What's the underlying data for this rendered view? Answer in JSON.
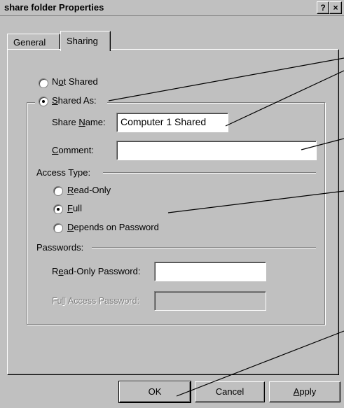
{
  "window": {
    "title": "share folder Properties",
    "help_btn": "?",
    "close_btn": "×"
  },
  "tabs": [
    {
      "label": "General",
      "active": false
    },
    {
      "label": "Sharing",
      "active": true
    }
  ],
  "sharing": {
    "not_shared": {
      "pre": "N",
      "acc": "o",
      "post": "t Shared",
      "selected": false
    },
    "shared_as": {
      "pre": "",
      "acc": "S",
      "post": "hared As:",
      "selected": true
    },
    "share_name": {
      "label_pre": "Share ",
      "label_acc": "N",
      "label_post": "ame:",
      "value": "Computer 1 Shared"
    },
    "comment": {
      "label_pre": "",
      "label_acc": "C",
      "label_post": "omment:",
      "value": ""
    },
    "access_type": {
      "heading": "Access Type:",
      "options": [
        {
          "pre": "",
          "acc": "R",
          "post": "ead-Only",
          "selected": false
        },
        {
          "pre": "",
          "acc": "F",
          "post": "ull",
          "selected": true
        },
        {
          "pre": "",
          "acc": "D",
          "post": "epends on Password",
          "selected": false
        }
      ]
    },
    "passwords": {
      "heading": "Passwords:",
      "read_only": {
        "pre": "R",
        "acc": "e",
        "post": "ad-Only Password:",
        "value": ""
      },
      "full_access": {
        "pre": "Fu",
        "acc": "l",
        "post": "l Access Password:",
        "value": "",
        "disabled": true
      }
    }
  },
  "buttons": {
    "ok": "OK",
    "cancel": "Cancel",
    "apply_acc": "A",
    "apply_post": "pply"
  }
}
